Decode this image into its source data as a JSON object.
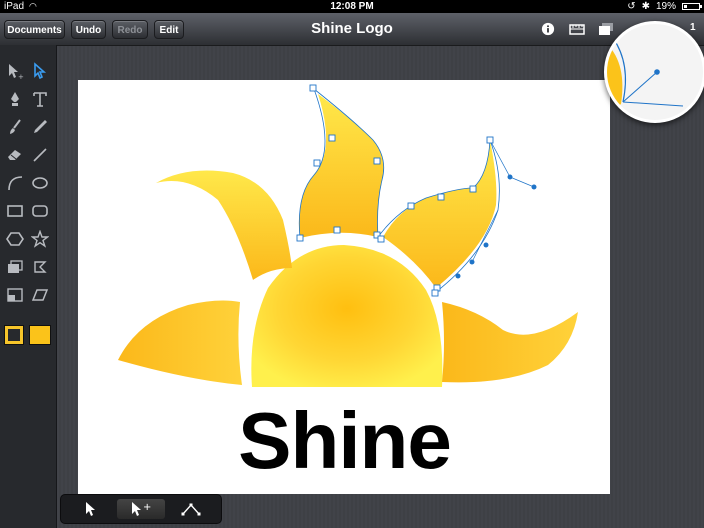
{
  "status_bar": {
    "device": "iPad",
    "time": "12:08 PM",
    "battery": "19%",
    "battery_level": 0.19
  },
  "toolbar": {
    "documents_label": "Documents",
    "undo_label": "Undo",
    "redo_label": "Redo",
    "edit_label": "Edit",
    "right_partial_label": "1"
  },
  "document": {
    "title": "Shine Logo",
    "text": "Shine"
  },
  "tools": [
    "selection-tool-icon",
    "direct-selection-icon",
    "pen-tool-icon",
    "text-tool-icon",
    "brush-tool-icon",
    "pencil-tool-icon",
    "eraser-tool-icon",
    "line-tool-icon",
    "arc-tool-icon",
    "ellipse-tool-icon",
    "rectangle-tool-icon",
    "rounded-rectangle-icon",
    "hexagon-tool-icon",
    "star-tool-icon",
    "image-place-icon",
    "lasso-tool-icon",
    "layer-tool-icon",
    "skew-tool-icon"
  ],
  "colors": {
    "stroke": "#f7c52a",
    "fill": "#fbc31a",
    "canvas": "#ffffff",
    "accent": "#1f74c8"
  },
  "select_modes": [
    "select",
    "add-select",
    "node-edit"
  ]
}
